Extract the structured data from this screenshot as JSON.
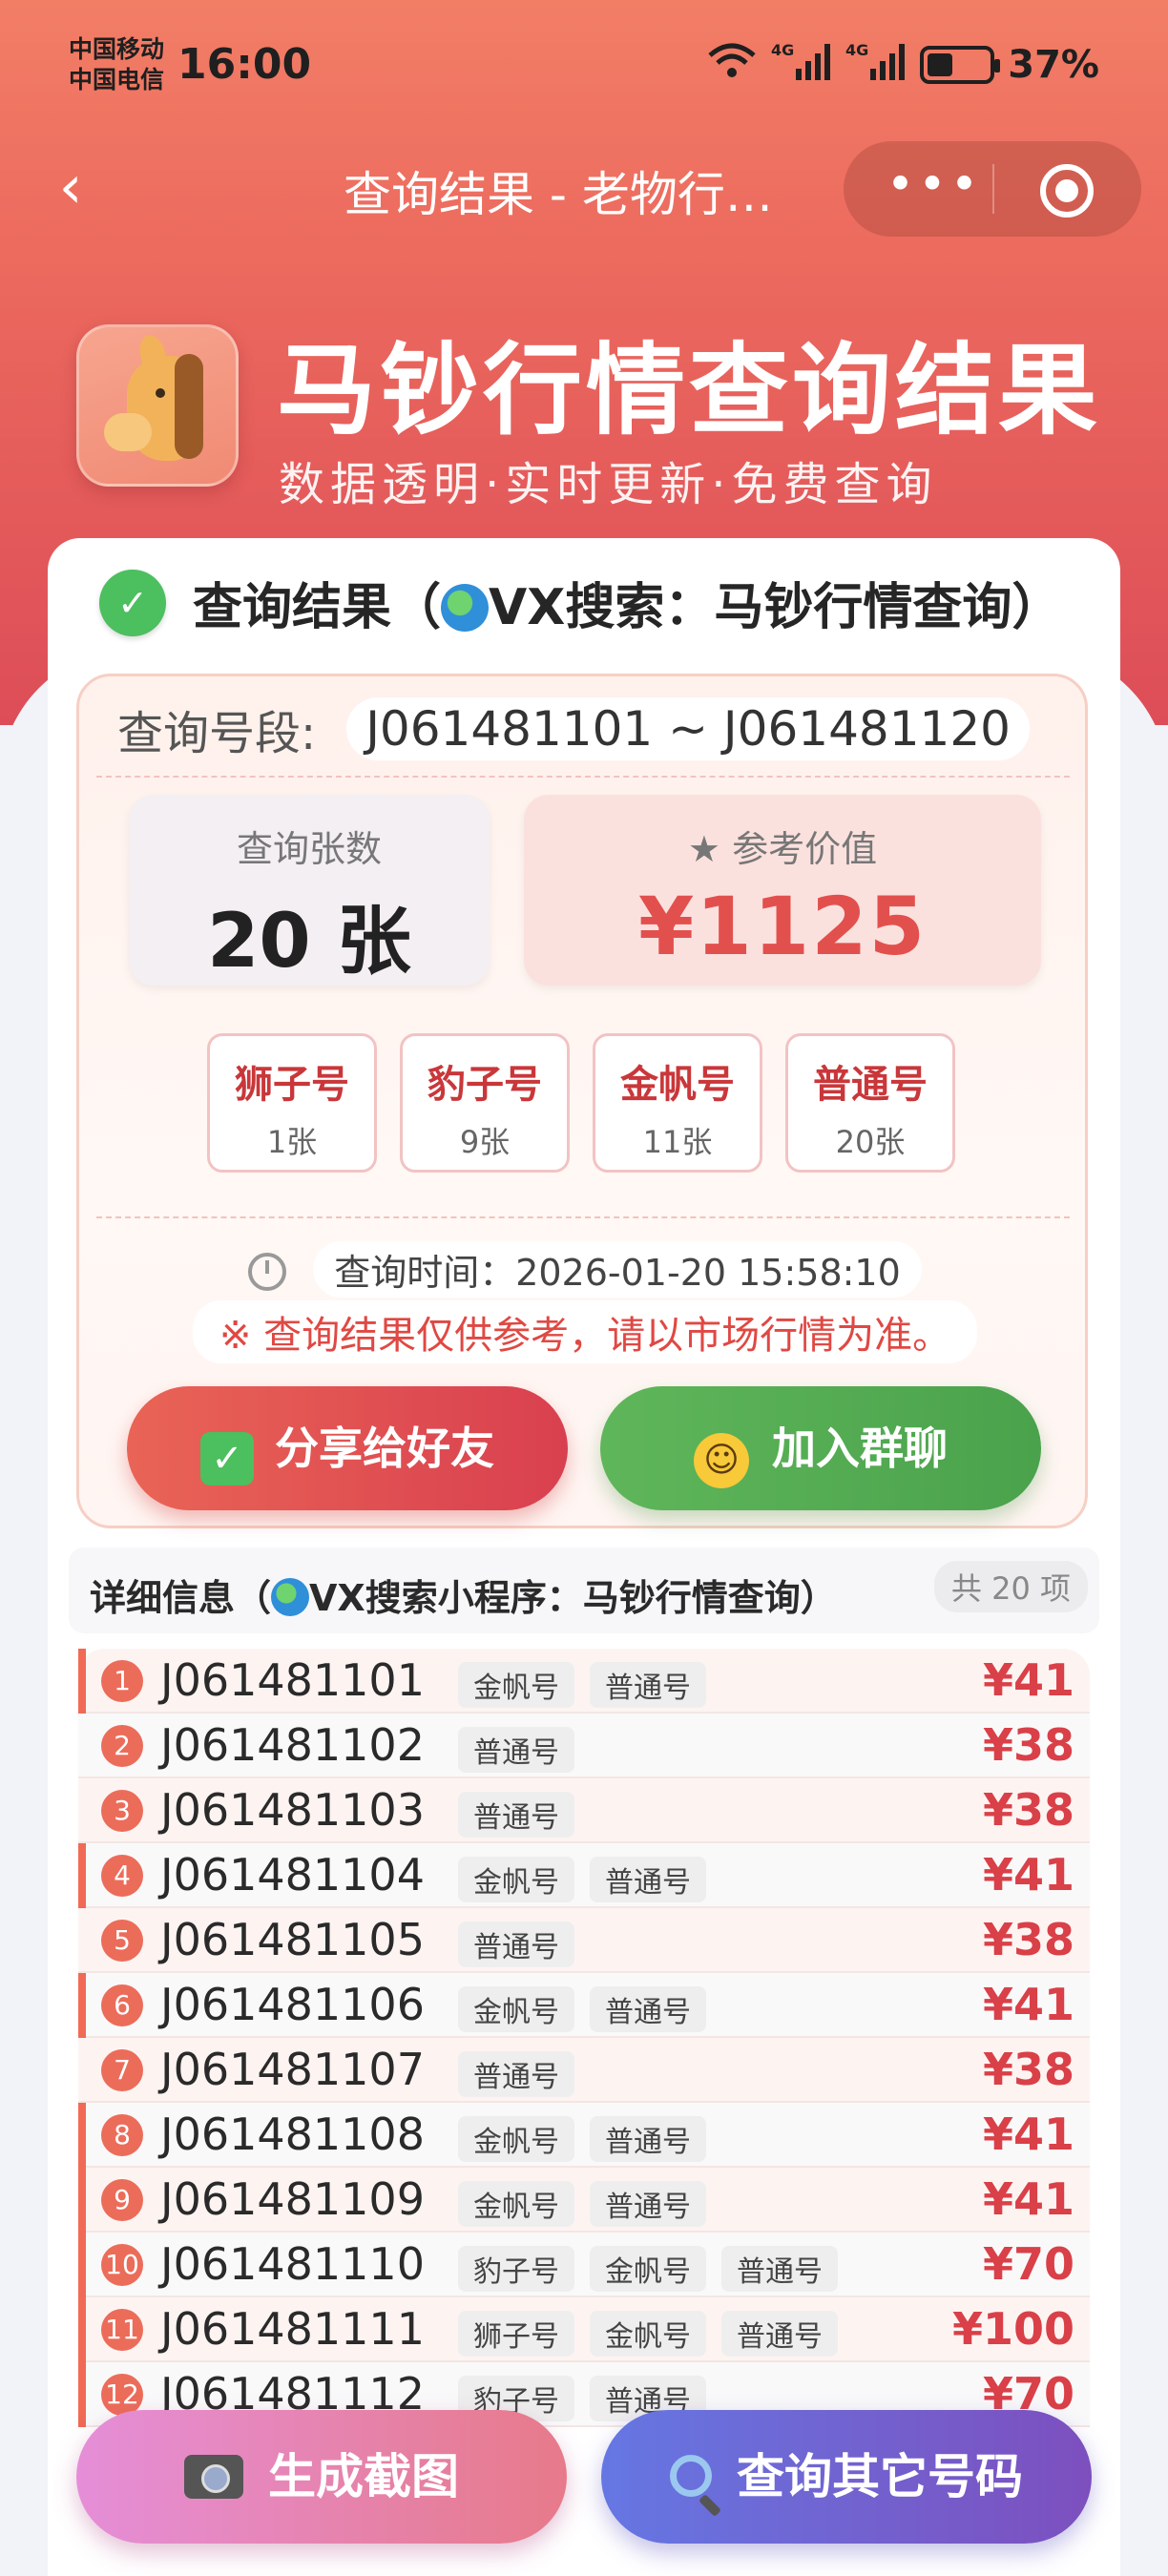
{
  "status_bar": {
    "carrier_1": "中国移动",
    "carrier_2": "中国电信",
    "time": "16:00",
    "network": "4G",
    "battery_percent": "37%",
    "battery_level": 0.37
  },
  "nav": {
    "title": "查询结果 - 老物行…",
    "more_icon": "more-dots-icon",
    "close_icon": "target-circle-icon"
  },
  "brand": {
    "title": "马钞行情查询结果",
    "subtitle": "数据透明·实时更新·免费查询",
    "logo_icon": "horse-icon"
  },
  "result": {
    "title": "查询结果（",
    "title_suffix": "VX搜索：马钞行情查询）",
    "range_label": "查询号段:",
    "range_value": "J061481101 ~ J061481120",
    "count_label": "查询张数",
    "count_value": "20 张",
    "value_label": "★ 参考价值",
    "value_amount": "¥1125",
    "tags": [
      {
        "name": "狮子号",
        "count": "1张"
      },
      {
        "name": "豹子号",
        "count": "9张"
      },
      {
        "name": "金帆号",
        "count": "11张"
      },
      {
        "name": "普通号",
        "count": "20张"
      }
    ],
    "query_time": "查询时间：2026-01-20 15:58:10",
    "note": "※ 查询结果仅供参考，请以市场行情为准。",
    "share_label": "分享给好友",
    "group_label": "加入群聊"
  },
  "details": {
    "title_prefix": "详细信息（",
    "title_suffix": "VX搜索小程序：马钞行情查询）",
    "count": "共 20 项",
    "rows": [
      {
        "idx": "1",
        "code": "J061481101",
        "tags": [
          "金帆号",
          "普通号"
        ],
        "price": "¥41"
      },
      {
        "idx": "2",
        "code": "J061481102",
        "tags": [
          "普通号"
        ],
        "price": "¥38"
      },
      {
        "idx": "3",
        "code": "J061481103",
        "tags": [
          "普通号"
        ],
        "price": "¥38"
      },
      {
        "idx": "4",
        "code": "J061481104",
        "tags": [
          "金帆号",
          "普通号"
        ],
        "price": "¥41"
      },
      {
        "idx": "5",
        "code": "J061481105",
        "tags": [
          "普通号"
        ],
        "price": "¥38"
      },
      {
        "idx": "6",
        "code": "J061481106",
        "tags": [
          "金帆号",
          "普通号"
        ],
        "price": "¥41"
      },
      {
        "idx": "7",
        "code": "J061481107",
        "tags": [
          "普通号"
        ],
        "price": "¥38"
      },
      {
        "idx": "8",
        "code": "J061481108",
        "tags": [
          "金帆号",
          "普通号"
        ],
        "price": "¥41"
      },
      {
        "idx": "9",
        "code": "J061481109",
        "tags": [
          "金帆号",
          "普通号"
        ],
        "price": "¥41"
      },
      {
        "idx": "10",
        "code": "J061481110",
        "tags": [
          "豹子号",
          "金帆号",
          "普通号"
        ],
        "price": "¥70"
      },
      {
        "idx": "11",
        "code": "J061481111",
        "tags": [
          "狮子号",
          "金帆号",
          "普通号"
        ],
        "price": "¥100"
      },
      {
        "idx": "12",
        "code": "J061481112",
        "tags": [
          "豹子号",
          "普通号"
        ],
        "price": "¥70"
      }
    ]
  },
  "fab": {
    "screenshot_label": "生成截图",
    "query_label": "查询其它号码"
  }
}
